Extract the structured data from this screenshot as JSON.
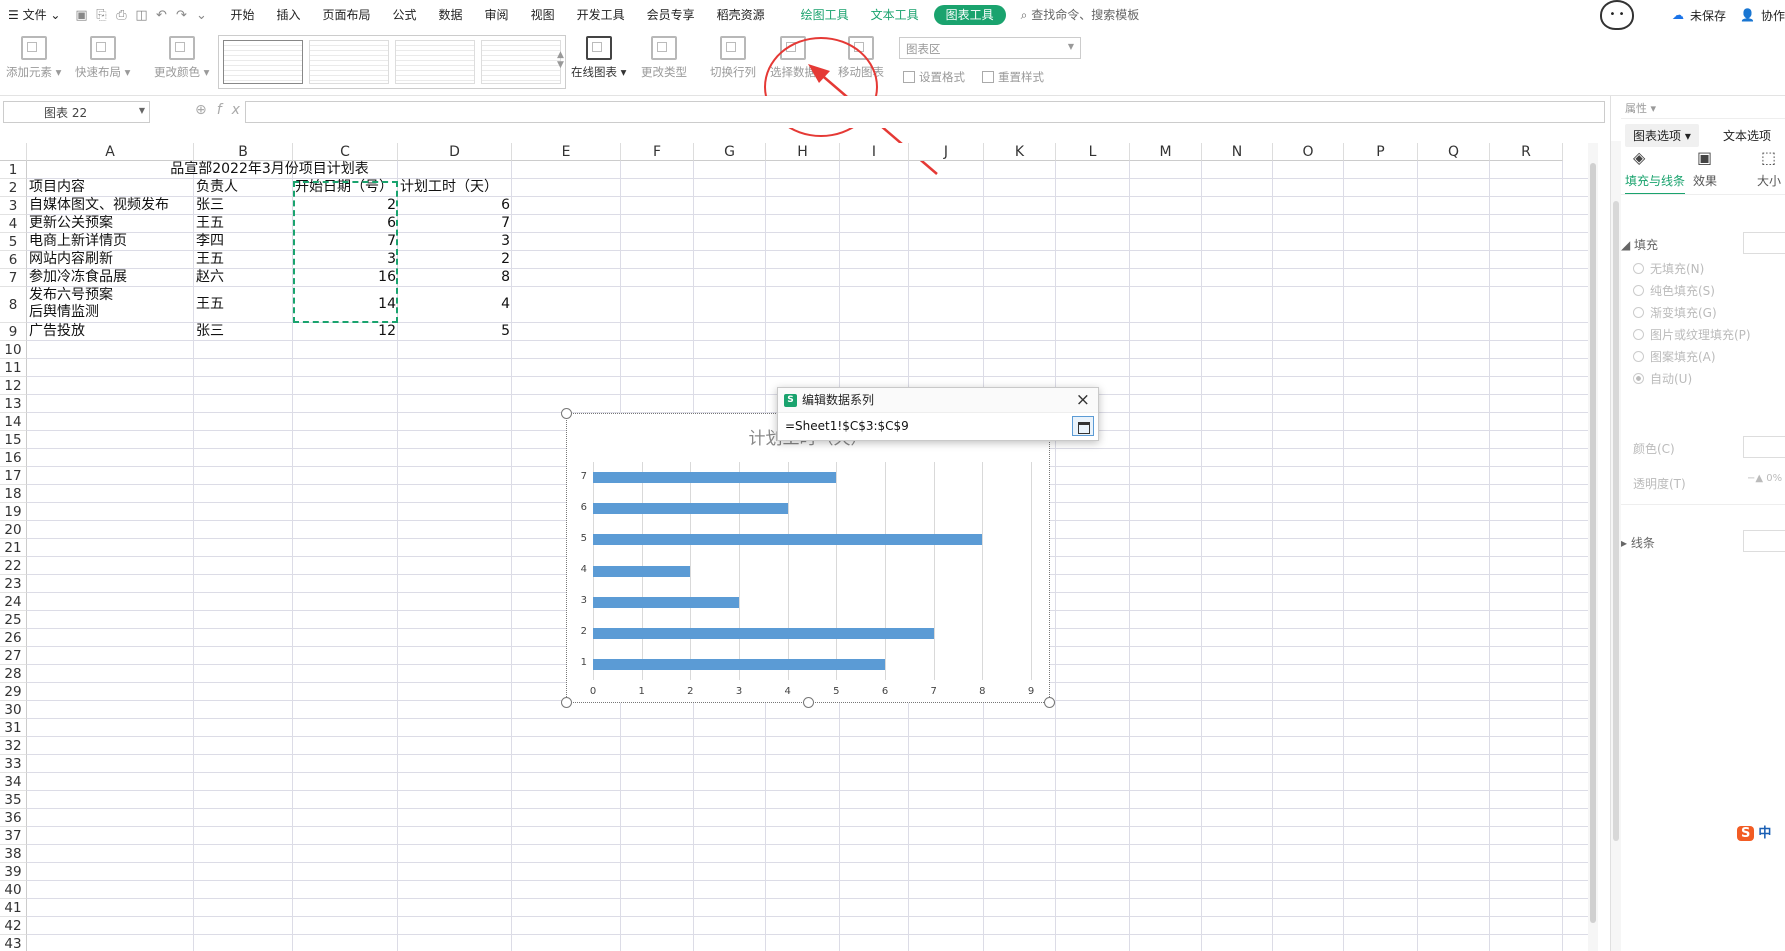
{
  "menu": {
    "file": "文件",
    "tabs": [
      "开始",
      "插入",
      "页面布局",
      "公式",
      "数据",
      "审阅",
      "视图",
      "开发工具",
      "会员专享",
      "稻壳资源"
    ],
    "ctx_tabs": [
      "绘图工具",
      "文本工具"
    ],
    "active_tab": "图表工具",
    "search": "查找命令、搜索模板",
    "unsaved": "未保存",
    "collab": "协作"
  },
  "ribbon": {
    "add_element": "添加元素",
    "quick_layout": "快速布局",
    "change_color": "更改颜色",
    "online_chart": "在线图表",
    "change_type": "更改类型",
    "switch_rowcol": "切换行列",
    "select_data": "选择数据",
    "move_chart": "移动图表",
    "chart_area": "图表区",
    "set_format": "设置格式",
    "reset_style": "重置样式"
  },
  "formula": {
    "name_box": "图表 22",
    "fx": "fx",
    "value": ""
  },
  "sheet": {
    "columns": [
      "A",
      "B",
      "C",
      "D",
      "E",
      "F",
      "G",
      "H",
      "I",
      "J",
      "K",
      "L",
      "M",
      "N",
      "O",
      "P",
      "Q",
      "R"
    ],
    "rows": [
      "1",
      "2",
      "3",
      "4",
      "5",
      "6",
      "7",
      "8",
      "9",
      "10",
      "11",
      "12",
      "13",
      "14",
      "15",
      "16",
      "17",
      "18",
      "19",
      "20",
      "21",
      "22",
      "23",
      "24",
      "25",
      "26",
      "27",
      "28",
      "29",
      "30",
      "31",
      "32",
      "33",
      "34",
      "35",
      "36",
      "37",
      "38",
      "39",
      "40",
      "41",
      "42",
      "43"
    ],
    "title": "品宣部2022年3月份项目计划表",
    "headers": [
      "项目内容",
      "负责人",
      "开始日期（号）",
      "计划工时（天）"
    ],
    "data": [
      {
        "item": "自媒体图文、视频发布",
        "owner": "张三",
        "start": "2",
        "days": "6"
      },
      {
        "item": "更新公关预案",
        "owner": "王五",
        "start": "6",
        "days": "7"
      },
      {
        "item": "电商上新详情页",
        "owner": "李四",
        "start": "7",
        "days": "3"
      },
      {
        "item": "网站内容刷新",
        "owner": "王五",
        "start": "3",
        "days": "2"
      },
      {
        "item": "参加冷冻食品展",
        "owner": "赵六",
        "start": "16",
        "days": "8"
      },
      {
        "item": "发布六号预案",
        "item2": "后舆情监测",
        "owner": "王五",
        "start": "14",
        "days": "4"
      },
      {
        "item": "广告投放",
        "owner": "张三",
        "start": "12",
        "days": "5"
      }
    ]
  },
  "chart_data": {
    "type": "bar",
    "orientation": "horizontal",
    "title": "计划工时（天）",
    "categories": [
      "1",
      "2",
      "3",
      "4",
      "5",
      "6",
      "7"
    ],
    "values": [
      6,
      7,
      3,
      2,
      8,
      4,
      5
    ],
    "xlim": [
      0,
      9
    ],
    "xticks": [
      "0",
      "1",
      "2",
      "3",
      "4",
      "5",
      "6",
      "7",
      "8",
      "9"
    ],
    "color": "#5b9bd5",
    "grid": true
  },
  "dialog": {
    "title": "编辑数据系列",
    "logo": "S",
    "ref": "=Sheet1!$C$3:$C$9",
    "close": "×"
  },
  "panel": {
    "header": "属性",
    "tab_chart_options": "图表选项",
    "tab_text_options": "文本选项",
    "sub_fill_line": "填充与线条",
    "sub_effect": "效果",
    "sub_size": "大小",
    "fill": "填充",
    "options": [
      "无填充(N)",
      "纯色填充(S)",
      "渐变填充(G)",
      "图片或纹理填充(P)",
      "图案填充(A)",
      "自动(U)"
    ],
    "color": "颜色(C)",
    "transparency": "透明度(T)",
    "transparency_val": "0%",
    "line": "线条",
    "ime": "中"
  }
}
